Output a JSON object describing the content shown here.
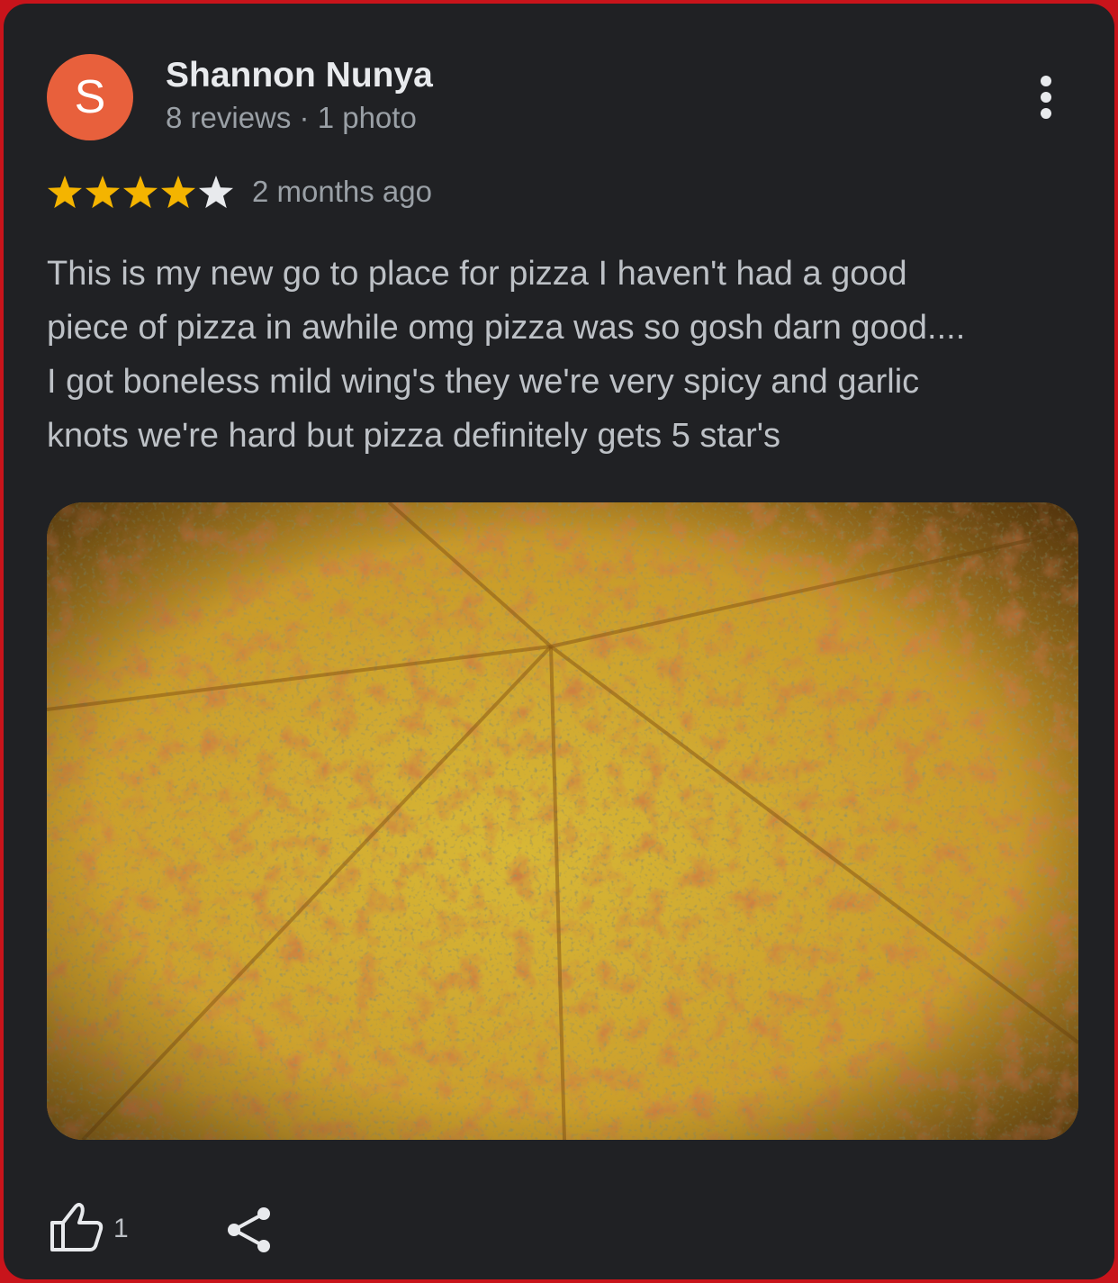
{
  "review": {
    "avatar_letter": "S",
    "avatar_color": "#e8603c",
    "reviewer_name": "Shannon Nunya",
    "reviewer_meta": "8 reviews · 1 photo",
    "rating": 4,
    "rating_max": 5,
    "time_ago": "2 months ago",
    "text": "This is my new go to place for pizza I haven't had a good\npiece of pizza in awhile omg pizza was so gosh darn good....\nI got boneless mild wing's they we're very spicy and garlic\nknots we're hard but pizza definitely gets 5 star's",
    "photo_description": "pizza-photo",
    "like_count": "1"
  },
  "icons": {
    "more": "more-vert-icon",
    "star": "star-icon",
    "like": "thumbs-up-icon",
    "share": "share-icon"
  },
  "colors": {
    "frame": "#c8141b",
    "card_bg": "#202124",
    "star_filled": "#f4b400",
    "star_empty": "#e8eaed"
  }
}
